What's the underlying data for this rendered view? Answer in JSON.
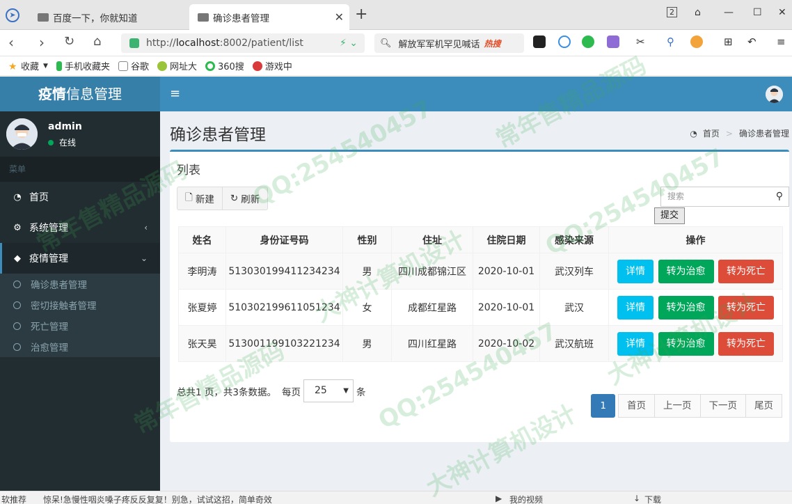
{
  "browser": {
    "tabs": [
      {
        "label": "百度一下，你就知道"
      },
      {
        "label": "确诊患者管理"
      }
    ],
    "new_tab": "+",
    "window_count": "2",
    "url_prefix": "http://",
    "url_host": "localhost",
    "url_rest": ":8002/patient/list",
    "search_text": "解放军军机罕见喊话",
    "search_hot": "热搜",
    "bookmarks": [
      "收藏",
      "手机收藏夹",
      "谷歌",
      "网址大",
      "360搜",
      "游戏中"
    ]
  },
  "app": {
    "brand_bold": "疫情",
    "brand_rest": "信息管理",
    "menu_toggle": "≡"
  },
  "user": {
    "name": "admin",
    "status": "在线"
  },
  "sidebar": {
    "header": "菜单",
    "items": [
      {
        "label": "首页",
        "icon": "dashboard-icon"
      },
      {
        "label": "系统管理",
        "icon": "gears-icon"
      },
      {
        "label": "疫情管理",
        "icon": "cube-icon"
      }
    ],
    "subitems": [
      "确诊患者管理",
      "密切接触者管理",
      "死亡管理",
      "治愈管理"
    ]
  },
  "page": {
    "title": "确诊患者管理",
    "breadcrumb": [
      "首页",
      "确诊患者管理"
    ],
    "box_title": "列表",
    "new_button": "新建",
    "refresh_button": "刷新",
    "search_placeholder": "搜索",
    "submit_button": "提交"
  },
  "table": {
    "headers": [
      "姓名",
      "身份证号码",
      "性别",
      "住址",
      "住院日期",
      "感染来源",
      "操作"
    ],
    "rows": [
      {
        "name": "李明涛",
        "id": "513030199411234234",
        "gender": "男",
        "address": "四川成都锦江区",
        "date": "2020-10-01",
        "source": "武汉列车"
      },
      {
        "name": "张夏婷",
        "id": "510302199611051234",
        "gender": "女",
        "address": "成都红星路",
        "date": "2020-10-01",
        "source": "武汉"
      },
      {
        "name": "张天昊",
        "id": "513001199103221234",
        "gender": "男",
        "address": "四川红星路",
        "date": "2020-10-02",
        "source": "武汉航班"
      }
    ],
    "actions": {
      "detail": "详情",
      "cure": "转为治愈",
      "death": "转为死亡"
    }
  },
  "pagination": {
    "summary": "总共1 页，共3条数据。",
    "per_page_label": "每页",
    "per_page_value": "25",
    "unit": "条",
    "current": "1",
    "first": "首页",
    "prev": "上一页",
    "next": "下一页",
    "last": "尾页"
  },
  "statusbar": {
    "left_label": "软推荐",
    "news": "惊呆!急慢性咽炎嗓子疼反反复复！别急，试试这招，简单奇效",
    "video": "我的视频",
    "download": "下载"
  },
  "watermarks": [
    "常年售精品源码",
    "QQ:254540457",
    "大神计算机设计"
  ],
  "colors": {
    "header": "#3c8dbc",
    "sidebar": "#222d32",
    "info": "#00c0ef",
    "success": "#00a65a",
    "danger": "#dd4b39"
  }
}
